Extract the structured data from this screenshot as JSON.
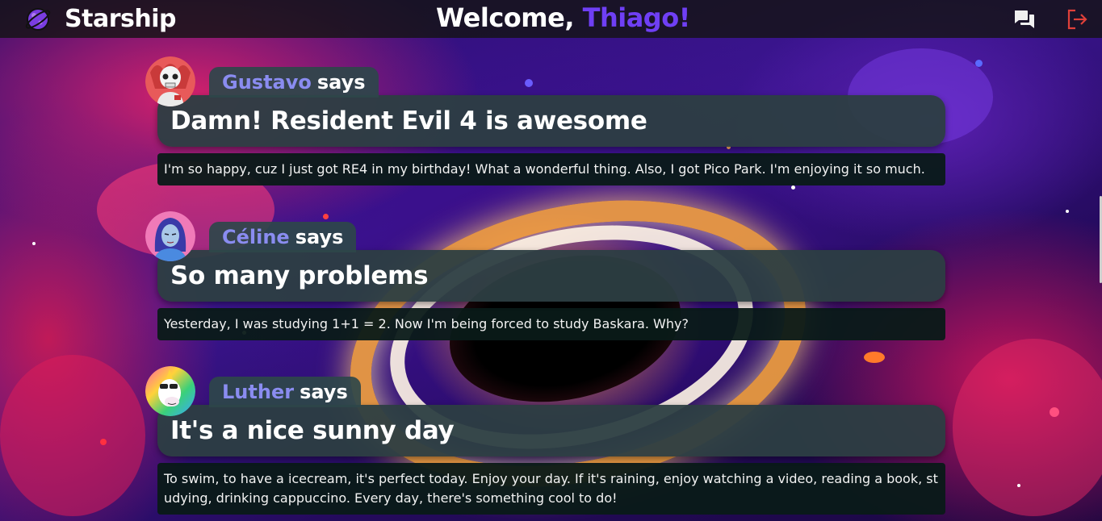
{
  "app": {
    "name": "Starship",
    "welcome_prefix": "Welcome,",
    "user_name": "Thiago!"
  },
  "header": {
    "icons": [
      "chat-icon",
      "logout-icon"
    ],
    "colors": {
      "accent": "#6f3ff5",
      "logout": "#e0403a"
    }
  },
  "posts": [
    {
      "author": "Gustavo",
      "says": "says",
      "title": "Damn! Resident Evil 4 is awesome",
      "body": "I'm so happy, cuz I just got RE4 in my birthday! What a wonderful thing. Also, I got Pico Park. I'm enjoying it so much."
    },
    {
      "author": "Céline",
      "says": "says",
      "title": "So many problems",
      "body": "Yesterday, I was studying 1+1 = 2. Now I'm being forced to study Baskara. Why?"
    },
    {
      "author": "Luther",
      "says": "says",
      "title": "It's a nice sunny day",
      "body": "To swim, to have a icecream, it's perfect today. Enjoy your day. If it's raining, enjoy watching a video, reading a book, studying, drinking cappuccino. Every day, there's something cool to do!"
    }
  ]
}
